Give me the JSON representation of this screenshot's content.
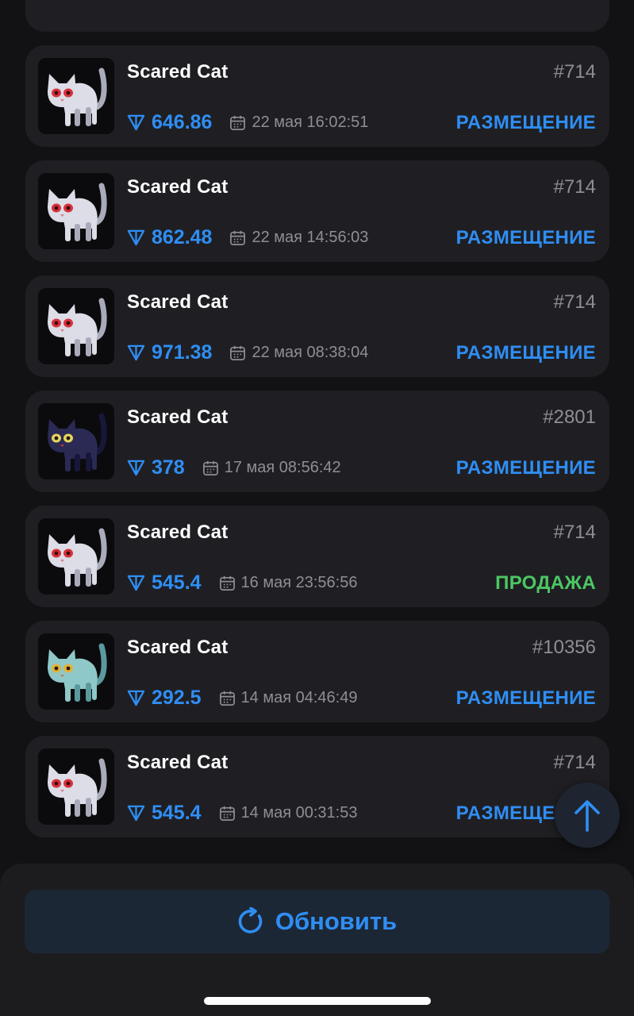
{
  "activity": {
    "items": [
      {
        "name": "Scared Cat",
        "number": "#714",
        "price": "646.86",
        "date": "22 мая 16:02:51",
        "action": "РАЗМЕЩЕНИЕ",
        "variant": "white"
      },
      {
        "name": "Scared Cat",
        "number": "#714",
        "price": "862.48",
        "date": "22 мая 14:56:03",
        "action": "РАЗМЕЩЕНИЕ",
        "variant": "white"
      },
      {
        "name": "Scared Cat",
        "number": "#714",
        "price": "971.38",
        "date": "22 мая 08:38:04",
        "action": "РАЗМЕЩЕНИЕ",
        "variant": "white"
      },
      {
        "name": "Scared Cat",
        "number": "#2801",
        "price": "378",
        "date": "17 мая 08:56:42",
        "action": "РАЗМЕЩЕНИЕ",
        "variant": "navy"
      },
      {
        "name": "Scared Cat",
        "number": "#714",
        "price": "545.4",
        "date": "16 мая 23:56:56",
        "action": "ПРОДАЖА",
        "variant": "white"
      },
      {
        "name": "Scared Cat",
        "number": "#10356",
        "price": "292.5",
        "date": "14 мая 04:46:49",
        "action": "РАЗМЕЩЕНИЕ",
        "variant": "teal"
      },
      {
        "name": "Scared Cat",
        "number": "#714",
        "price": "545.4",
        "date": "14 мая 00:31:53",
        "action": "РАЗМЕЩЕНИЕ",
        "variant": "white"
      }
    ]
  },
  "footer": {
    "refresh_label": "Обновить"
  },
  "icons": {
    "currency": "ton-diamond-icon",
    "date": "calendar-icon",
    "refresh": "refresh-icon",
    "scroll_top": "arrow-up-icon"
  },
  "colors": {
    "accent": "#2f8ef4",
    "sale": "#4cc764",
    "card": "#1f1f23",
    "background": "#121214",
    "muted": "#8e8e93"
  }
}
